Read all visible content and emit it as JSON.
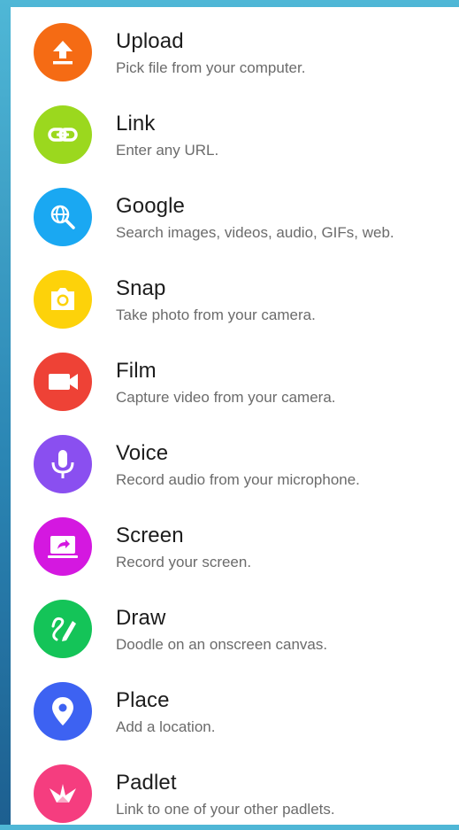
{
  "items": [
    {
      "label": "Upload",
      "description": "Pick file from your computer.",
      "icon": "upload-icon",
      "color": "#f56b14"
    },
    {
      "label": "Link",
      "description": "Enter any URL.",
      "icon": "link-icon",
      "color": "#9bd81e"
    },
    {
      "label": "Google",
      "description": "Search images, videos, audio, GIFs, web.",
      "icon": "globe-search-icon",
      "color": "#1aa8f2"
    },
    {
      "label": "Snap",
      "description": "Take photo from your camera.",
      "icon": "camera-icon",
      "color": "#fdd20a"
    },
    {
      "label": "Film",
      "description": "Capture video from your camera.",
      "icon": "video-camera-icon",
      "color": "#ee4236"
    },
    {
      "label": "Voice",
      "description": "Record audio from your microphone.",
      "icon": "microphone-icon",
      "color": "#8a4ff0"
    },
    {
      "label": "Screen",
      "description": "Record your screen.",
      "icon": "screen-share-icon",
      "color": "#d418e0"
    },
    {
      "label": "Draw",
      "description": "Doodle on an onscreen canvas.",
      "icon": "draw-pencil-icon",
      "color": "#14c458"
    },
    {
      "label": "Place",
      "description": "Add a location.",
      "icon": "location-pin-icon",
      "color": "#3d62f2"
    },
    {
      "label": "Padlet",
      "description": "Link to one of your other padlets.",
      "icon": "padlet-bird-icon",
      "color": "#f53d7f"
    }
  ]
}
